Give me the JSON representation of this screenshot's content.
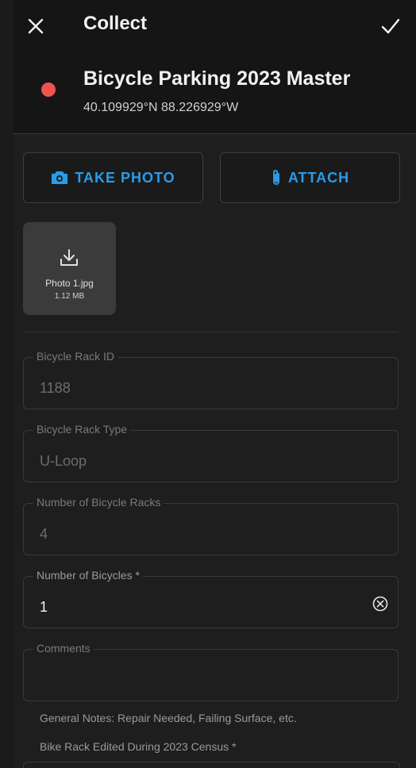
{
  "header": {
    "title": "Collect",
    "layer_name": "Bicycle Parking 2023 Master",
    "coordinates": "40.109929°N  88.226929°W",
    "status_color": "#ef5350"
  },
  "actions": {
    "take_photo_label": "TAKE PHOTO",
    "attach_label": "ATTACH"
  },
  "attachment": {
    "file_name": "Photo 1.jpg",
    "file_size": "1.12 MB"
  },
  "fields": [
    {
      "label": "Bicycle Rack ID",
      "value": "1188"
    },
    {
      "label": "Bicycle Rack Type",
      "value": "U-Loop"
    },
    {
      "label": "Number of Bicycle Racks",
      "value": "4"
    },
    {
      "label": "Number of Bicycles *",
      "value": "1"
    },
    {
      "label": "Comments",
      "value": ""
    }
  ],
  "hints": {
    "comments_hint": "General Notes: Repair Needed, Failing Surface, etc.",
    "next_field_label": "Bike Rack Edited During 2023 Census *"
  },
  "colors": {
    "accent": "#2b9be8",
    "background": "#1e1e1e",
    "header": "#151515"
  }
}
